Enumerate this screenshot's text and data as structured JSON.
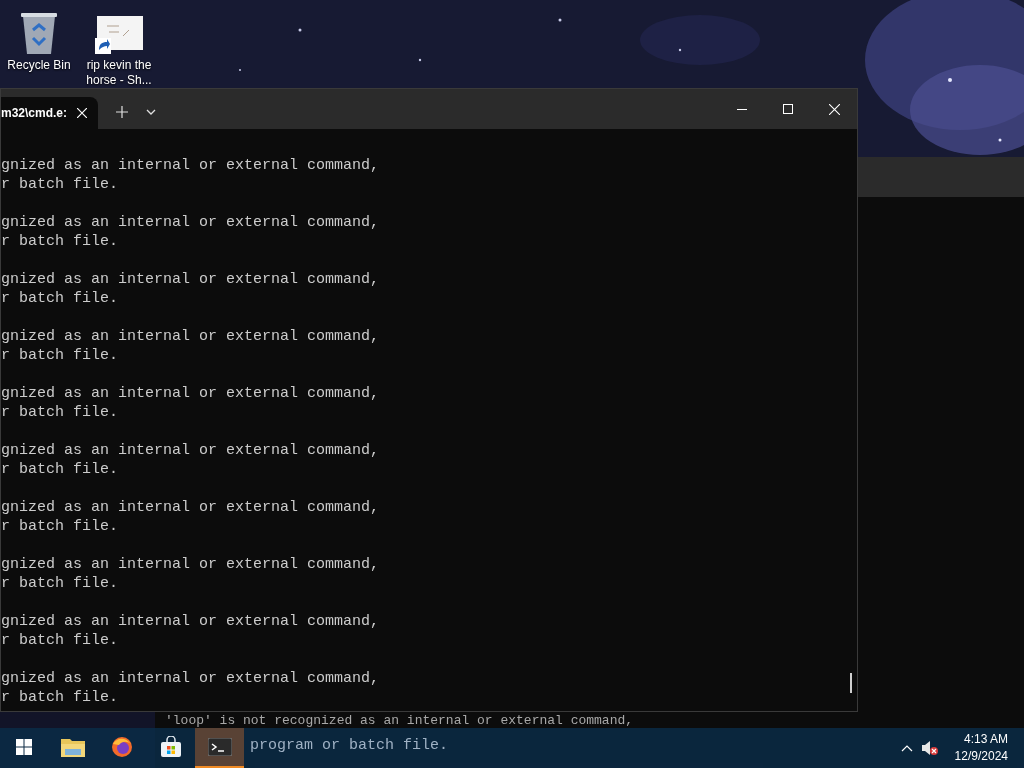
{
  "desktop_icons": [
    {
      "kind": "recycle",
      "label": "Recycle Bin"
    },
    {
      "kind": "shortcut",
      "label": "rip kevin the horse - Sh..."
    }
  ],
  "background_window": {
    "lines": [
      "'loop' is not recognized as an internal or external command,",
      "program or batch file."
    ]
  },
  "terminal": {
    "tab": {
      "title": "m32\\cmd.e:",
      "selected": true
    },
    "blocks": [
      [
        "gnized as an internal or external command,",
        "r batch file."
      ],
      [
        "gnized as an internal or external command,",
        "r batch file."
      ],
      [
        "gnized as an internal or external command,",
        "r batch file."
      ],
      [
        "gnized as an internal or external command,",
        "r batch file."
      ],
      [
        "gnized as an internal or external command,",
        "r batch file."
      ],
      [
        "gnized as an internal or external command,",
        "r batch file."
      ],
      [
        "gnized as an internal or external command,",
        "r batch file."
      ],
      [
        "gnized as an internal or external command,",
        "r batch file."
      ],
      [
        "gnized as an internal or external command,",
        "r batch file."
      ],
      [
        "gnized as an internal or external command,",
        "r batch file."
      ]
    ]
  },
  "taskbar": {
    "apps": [
      {
        "kind": "start",
        "selected": false
      },
      {
        "kind": "folder",
        "selected": false
      },
      {
        "kind": "firefox",
        "selected": false
      },
      {
        "kind": "store",
        "selected": false
      },
      {
        "kind": "terminal",
        "selected": true
      }
    ],
    "time": "4:13 AM",
    "date": "12/9/2024"
  }
}
